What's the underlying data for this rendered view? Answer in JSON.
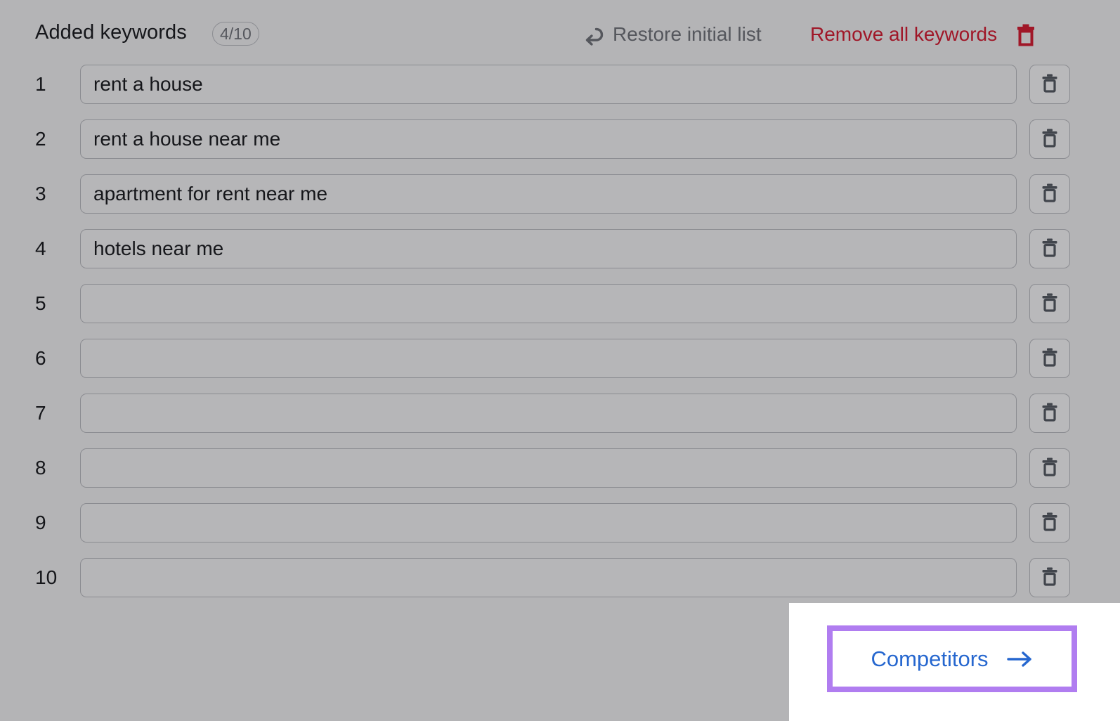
{
  "header": {
    "title": "Added keywords",
    "badge": "4/10",
    "restore_label": "Restore initial list",
    "restore_icon": "undo-arrow-icon",
    "remove_all_label": "Remove all keywords",
    "remove_all_icon": "trash-icon"
  },
  "keywords": {
    "row_delete_icon": "trash-icon",
    "rows": [
      {
        "index": "1",
        "value": "rent a house"
      },
      {
        "index": "2",
        "value": "rent a house near me"
      },
      {
        "index": "3",
        "value": "apartment for rent near me"
      },
      {
        "index": "4",
        "value": "hotels near me"
      },
      {
        "index": "5",
        "value": ""
      },
      {
        "index": "6",
        "value": ""
      },
      {
        "index": "7",
        "value": ""
      },
      {
        "index": "8",
        "value": ""
      },
      {
        "index": "9",
        "value": ""
      },
      {
        "index": "10",
        "value": ""
      }
    ]
  },
  "competitors": {
    "label": "Competitors",
    "arrow_icon": "arrow-right-icon"
  },
  "colors": {
    "background": "#b4b4b6",
    "text": "#15161a",
    "muted_text": "#55575d",
    "danger": "#a01728",
    "link": "#2667cf",
    "highlight": "#b07df0",
    "panel": "#ffffff",
    "border": "#8b8c91"
  }
}
